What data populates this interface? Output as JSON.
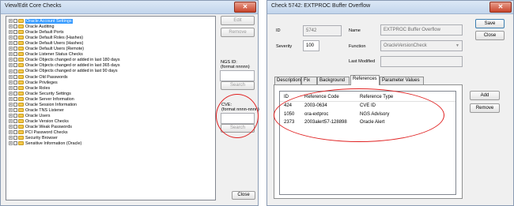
{
  "left_window": {
    "title": "View/Edit Core Checks",
    "close_glyph": "✕",
    "tree_items": [
      {
        "label": "Oracle Account Settings",
        "selected": true
      },
      {
        "label": "Oracle Auditing"
      },
      {
        "label": "Oracle Default Ports"
      },
      {
        "label": "Oracle Default Roles (Hashes)"
      },
      {
        "label": "Oracle Default Users (Hashes)"
      },
      {
        "label": "Oracle Default Users (Remote)"
      },
      {
        "label": "Oracle Listener Status Checks"
      },
      {
        "label": "Oracle Objects changed or added in last 180 days"
      },
      {
        "label": "Oracle Objects changed or added in last 365 days"
      },
      {
        "label": "Oracle Objects changed or added in last 90 days"
      },
      {
        "label": "Oracle Old Passwords"
      },
      {
        "label": "Oracle Privileges"
      },
      {
        "label": "Oracle Roles"
      },
      {
        "label": "Oracle Security Settings"
      },
      {
        "label": "Oracle Server Information"
      },
      {
        "label": "Oracle Session Information"
      },
      {
        "label": "Oracle TNS Listener"
      },
      {
        "label": "Oracle Users"
      },
      {
        "label": "Oracle Version Checks"
      },
      {
        "label": "Oracle Weak Passwords"
      },
      {
        "label": "PCI Password Checks"
      },
      {
        "label": "Security Browser"
      },
      {
        "label": "Sensitive Information (Oracle)"
      }
    ],
    "edit_button": "Edit",
    "remove_button": "Remove",
    "ngs_id_label_line1": "NGS ID:",
    "ngs_id_label_line2": "(format nnnnn)",
    "ngs_search_button": "Search",
    "cve_label_line1": "CVE:",
    "cve_label_line2": "(format nnnn-nnnn)",
    "cve_search_button": "Search",
    "close_button": "Close"
  },
  "right_window": {
    "title": "Check 5742: EXTPROC Buffer Overflow",
    "close_glyph": "✕",
    "id_label": "ID",
    "id_value": "5742",
    "name_label": "Name",
    "name_value": "EXTPROC Buffer Overflow",
    "severity_label": "Severity",
    "severity_value": "100",
    "function_label": "Function",
    "function_value": "OracleVersionCheck",
    "last_modified_label": "Last Modified",
    "last_modified_value": "",
    "save_button": "Save",
    "close_button": "Close",
    "tabs": [
      "Description",
      "Fix",
      "Background",
      "References",
      "Parameter Values"
    ],
    "active_tab": "References",
    "columns": [
      "ID",
      "Reference Code",
      "Reference Type"
    ],
    "rows": [
      [
        "424",
        "2003-0634",
        "CVE ID"
      ],
      [
        "1050",
        "ora-extproc",
        "NGS Advisory"
      ],
      [
        "2373",
        "2003alert57-128898",
        "Oracle Alert"
      ]
    ],
    "add_button": "Add",
    "remove_button": "Remove"
  },
  "annotation_color": "#e02020"
}
